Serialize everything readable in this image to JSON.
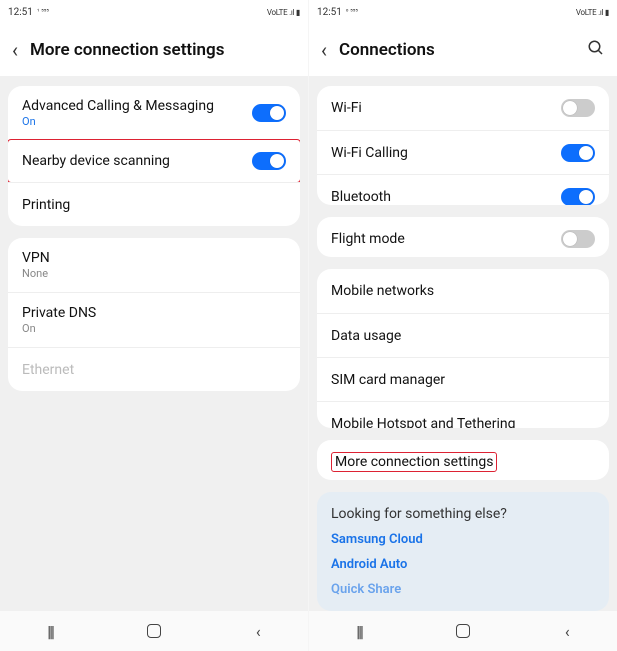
{
  "left": {
    "status_time": "12:51",
    "status_left_extras": "¹ ⁵⁵⁵",
    "status_right": "VoLTE  .ıl  ▮",
    "title": "More connection settings",
    "section1": [
      {
        "label": "Advanced Calling & Messaging",
        "sub": "On",
        "sub_on": true,
        "toggle": true,
        "toggle_on": true
      },
      {
        "label": "Nearby device scanning",
        "toggle": true,
        "toggle_on": true,
        "highlight": true
      },
      {
        "label": "Printing"
      }
    ],
    "section2": [
      {
        "label": "VPN",
        "sub": "None"
      },
      {
        "label": "Private DNS",
        "sub": "On"
      },
      {
        "label": "Ethernet",
        "disabled": true
      }
    ]
  },
  "right": {
    "status_time": "12:51",
    "status_left_extras": "⁰ ⁵⁵⁵",
    "status_right": "VoLTE  .ıl  ▮",
    "title": "Connections",
    "search": true,
    "section1": [
      {
        "label": "Wi-Fi",
        "toggle": true,
        "toggle_on": false
      },
      {
        "label": "Wi-Fi Calling",
        "toggle": true,
        "toggle_on": true
      },
      {
        "label": "Bluetooth",
        "toggle": true,
        "toggle_on": true
      }
    ],
    "section2": [
      {
        "label": "Flight mode",
        "toggle": true,
        "toggle_on": false
      }
    ],
    "section3": [
      {
        "label": "Mobile networks"
      },
      {
        "label": "Data usage"
      },
      {
        "label": "SIM card manager"
      },
      {
        "label": "Mobile Hotspot and Tethering"
      }
    ],
    "section4": [
      {
        "label": "More connection settings",
        "highlight_inline": true
      }
    ],
    "footer": {
      "title": "Looking for something else?",
      "links": [
        "Samsung Cloud",
        "Android Auto",
        "Quick Share"
      ]
    }
  }
}
